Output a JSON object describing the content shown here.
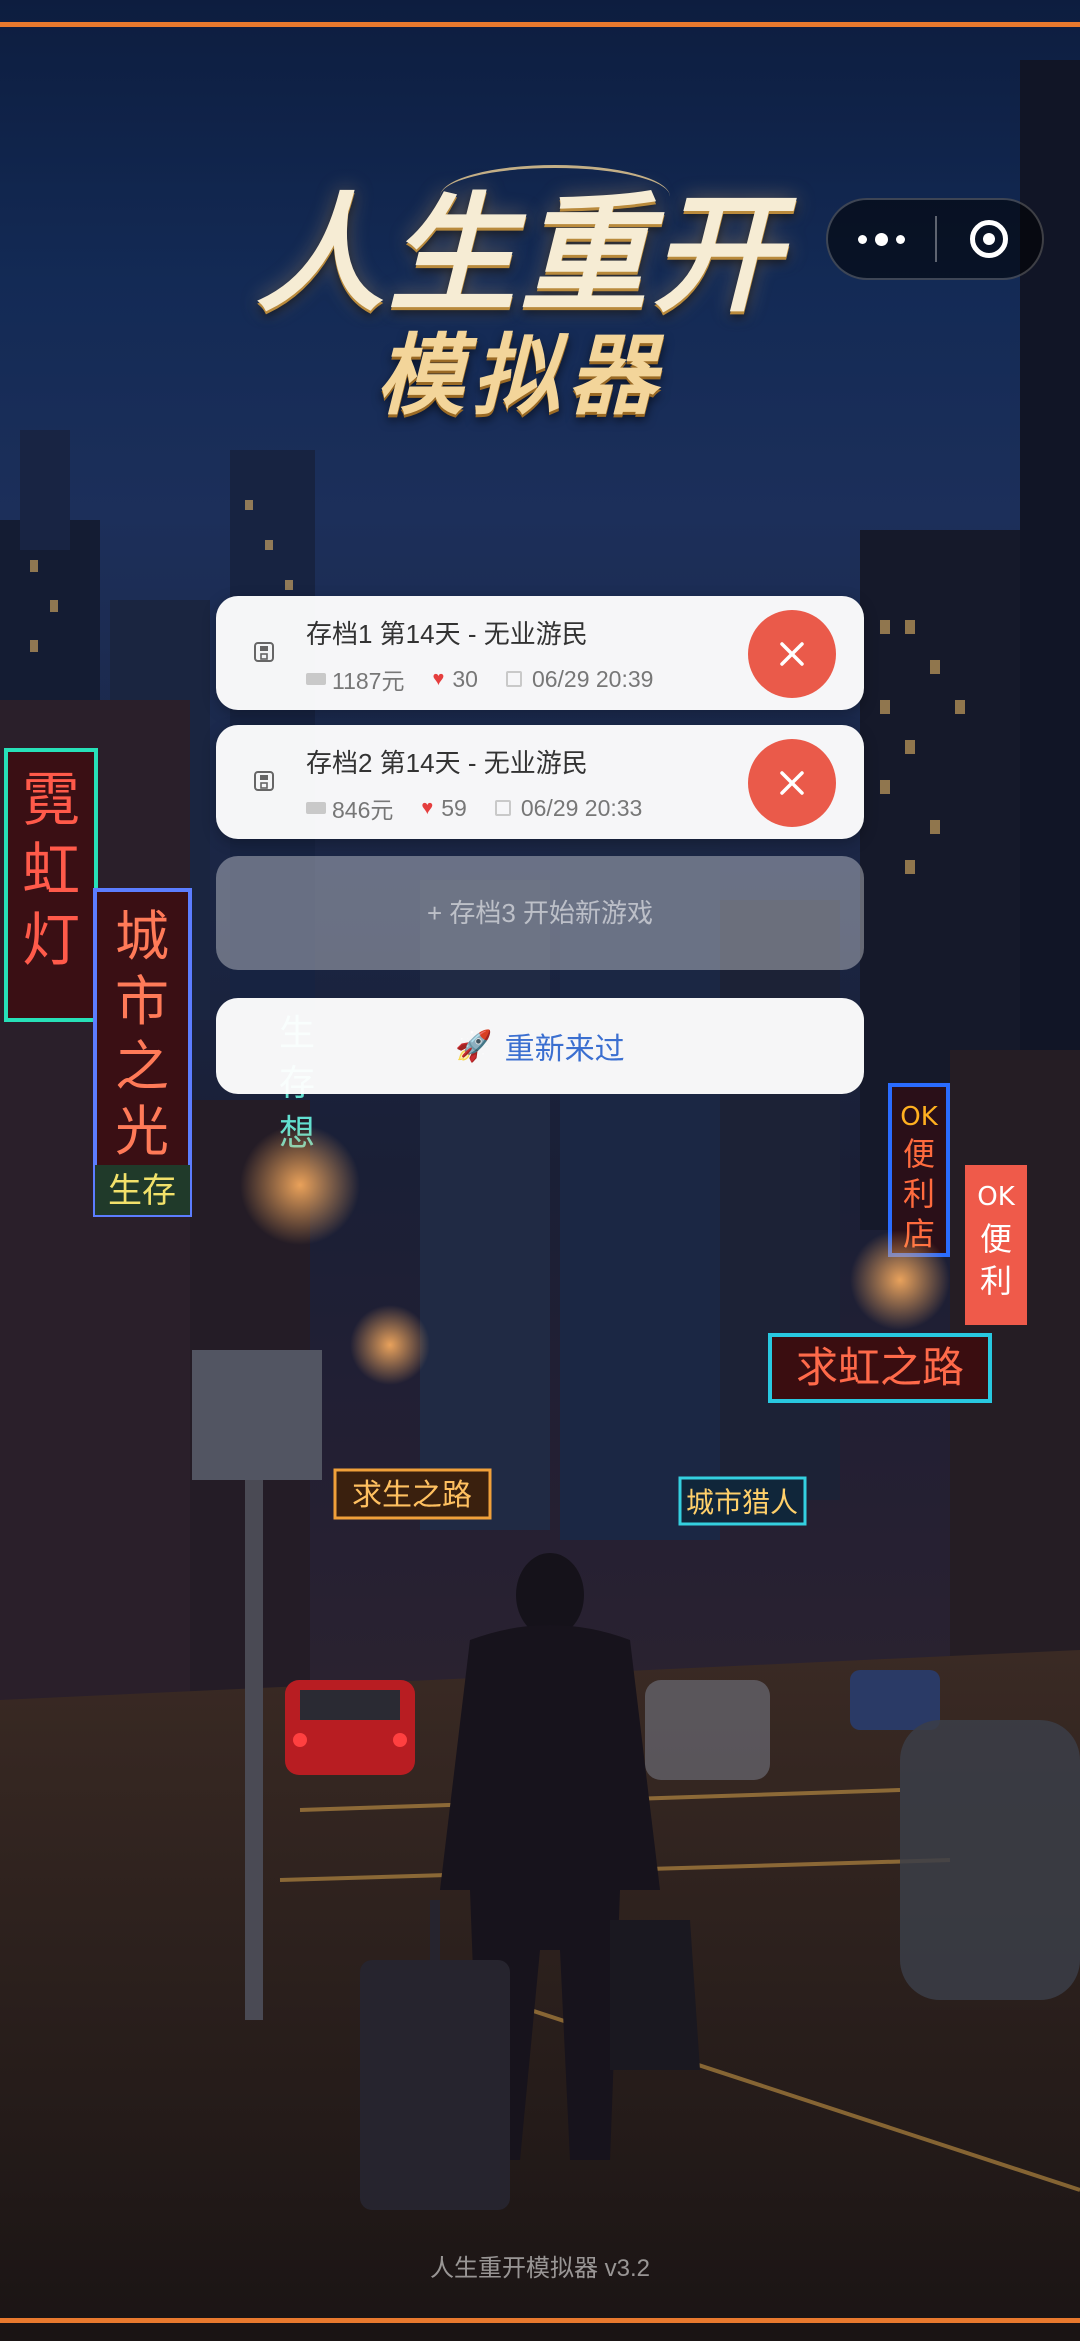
{
  "logo": {
    "line1": "人生重开",
    "line2": "模拟器"
  },
  "saves": [
    {
      "title": "存档1 第14天 - 无业游民",
      "money": "1187元",
      "health": "30",
      "time": "06/29 20:39"
    },
    {
      "title": "存档2 第14天 - 无业游民",
      "money": "846元",
      "health": "59",
      "time": "06/29 20:33"
    }
  ],
  "empty_slot": {
    "label": "+ 存档3 开始新游戏"
  },
  "restart": {
    "label": "重新来过"
  },
  "background": {
    "signs": [
      "霓虹灯",
      "城市之光",
      "生存",
      "OK便利店",
      "OK便利",
      "求虹之路",
      "求生之路",
      "生存想",
      "城市猎人"
    ]
  },
  "footer": {
    "version": "人生重开模拟器 v3.2"
  },
  "colors": {
    "accent_bar": "#e8792e",
    "delete": "#ea5a4a",
    "restart_text": "#3b6fd0"
  }
}
